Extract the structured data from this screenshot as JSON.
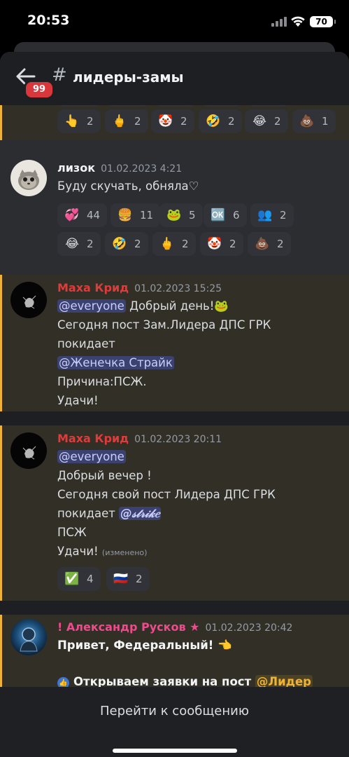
{
  "status_bar": {
    "time": "20:53",
    "battery": "70"
  },
  "header": {
    "unread_badge": "99",
    "hash": "#",
    "channel": "лидеры-замы"
  },
  "colors": {
    "mention_bar": "#f0b232",
    "badge": "#da373c",
    "author_red": "#e03b3b",
    "author_pink": "#f04a8c",
    "mention_blue": "#3c4270"
  },
  "top_reactions": [
    {
      "icon": "block-pointer-icon",
      "emoji": "👆",
      "count": "2"
    },
    {
      "icon": "middle-finger-icon",
      "emoji": "🖕",
      "count": "2"
    },
    {
      "icon": "clown-icon",
      "emoji": "🤡",
      "count": "2"
    },
    {
      "icon": "rofl-icon",
      "emoji": "🤣",
      "count": "2"
    },
    {
      "icon": "joy-icon",
      "emoji": "😂",
      "count": "2"
    },
    {
      "icon": "poop-icon",
      "emoji": "💩",
      "count": "1"
    }
  ],
  "messages": [
    {
      "author": "лизок",
      "time": "01.02.2023 4:21",
      "text": "Буду скучать, обняла♡",
      "reactions": [
        {
          "icon": "hearts-icon",
          "emoji": "💞",
          "count": "44"
        },
        {
          "icon": "burger-icon",
          "emoji": "🍔",
          "count": "11"
        },
        {
          "icon": "pepe-icon",
          "emoji": "🐸",
          "count": "5"
        },
        {
          "icon": "ok-icon",
          "emoji": "🆗",
          "count": "6"
        },
        {
          "icon": "people-icon",
          "emoji": "👥",
          "count": "2"
        },
        {
          "icon": "joy-icon",
          "emoji": "😂",
          "count": "2"
        },
        {
          "icon": "rofl-icon",
          "emoji": "🤣",
          "count": "2"
        },
        {
          "icon": "middle-finger-icon",
          "emoji": "🖕",
          "count": "2"
        },
        {
          "icon": "clown-icon",
          "emoji": "🤡",
          "count": "2"
        },
        {
          "icon": "poop-icon",
          "emoji": "💩",
          "count": "2"
        }
      ]
    },
    {
      "author": "Маха Крид",
      "time": "01.02.2023 15:25",
      "mention1": "@everyone",
      "line1_rest": " Добрый день!",
      "line2": "Сегодня пост Зам.Лидера ДПС ГРК",
      "line3": "покидает",
      "mention2": "@Женечка Страйк",
      "line5": "Причина:ПСЖ.",
      "line6": "Удачи!"
    },
    {
      "author": "Маха Крид",
      "time": "01.02.2023 20:11",
      "mention1": "@everyone",
      "line2": "Добрый вечер !",
      "line3": "Сегодня  свой пост Лидера ДПС ГРК",
      "line4": "покидает ",
      "mention2": "@𝓈𝓉𝓇𝒾𝓀𝑒",
      "line5": "ПСЖ",
      "line6": "Удачи! ",
      "edited": "(изменено)",
      "reactions": [
        {
          "icon": "check-icon",
          "emoji": "✅",
          "count": "4"
        },
        {
          "icon": "russia-flag-icon",
          "emoji": "🇷🇺",
          "count": "2"
        }
      ]
    },
    {
      "author": "! Александр Русков ★",
      "time": "01.02.2023 20:42",
      "line1": "Привет, Федеральный! 👈",
      "line2_pre": "Открываем заявки на пост ",
      "mention": "@Лидер"
    }
  ],
  "bottom": {
    "jump_label": "Перейти к сообщению"
  }
}
